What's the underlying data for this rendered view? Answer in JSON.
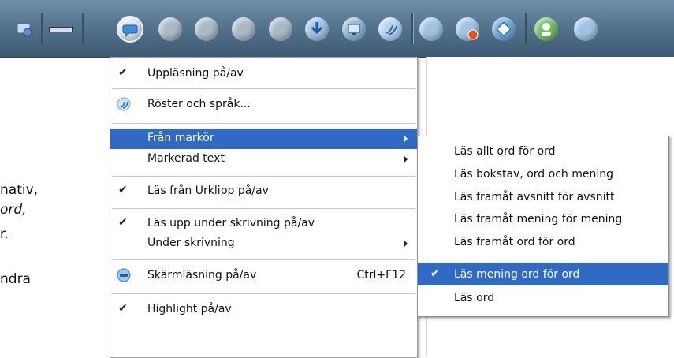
{
  "left_text": [
    "nativ,",
    "ord,",
    "r.",
    "ndra"
  ],
  "menu": {
    "items": [
      {
        "label": "Uppläsning på/av",
        "checked": true
      },
      {
        "label": "Röster och språk...",
        "icon": "voices-icon"
      },
      {
        "label": "Från markör",
        "submenu": true,
        "highlighted": true
      },
      {
        "label": "Markerad text",
        "submenu": true
      },
      {
        "label": "Läs från Urklipp på/av",
        "checked": true
      },
      {
        "label": "Läs upp under skrivning på/av",
        "checked": true
      },
      {
        "label": "Under skrivning",
        "submenu": true
      },
      {
        "label": "Skärmläsning på/av",
        "icon": "screen-reading-icon",
        "shortcut": "Ctrl+F12"
      },
      {
        "label": "Highlight på/av",
        "checked": true
      }
    ]
  },
  "submenu": {
    "items": [
      {
        "label": "Läs allt ord för ord"
      },
      {
        "label": "Läs bokstav, ord och mening"
      },
      {
        "label": "Läs framåt avsnitt för avsnitt"
      },
      {
        "label": "Läs framåt mening för mening"
      },
      {
        "label": "Läs framåt ord för ord"
      },
      {
        "label": "Läs mening ord för ord",
        "checked": true,
        "highlighted": true
      },
      {
        "label": "Läs ord"
      }
    ]
  },
  "icons": {
    "checkmark": "✔"
  },
  "colors": {
    "highlight": "#316ac5",
    "toolbar": "#506f89"
  }
}
